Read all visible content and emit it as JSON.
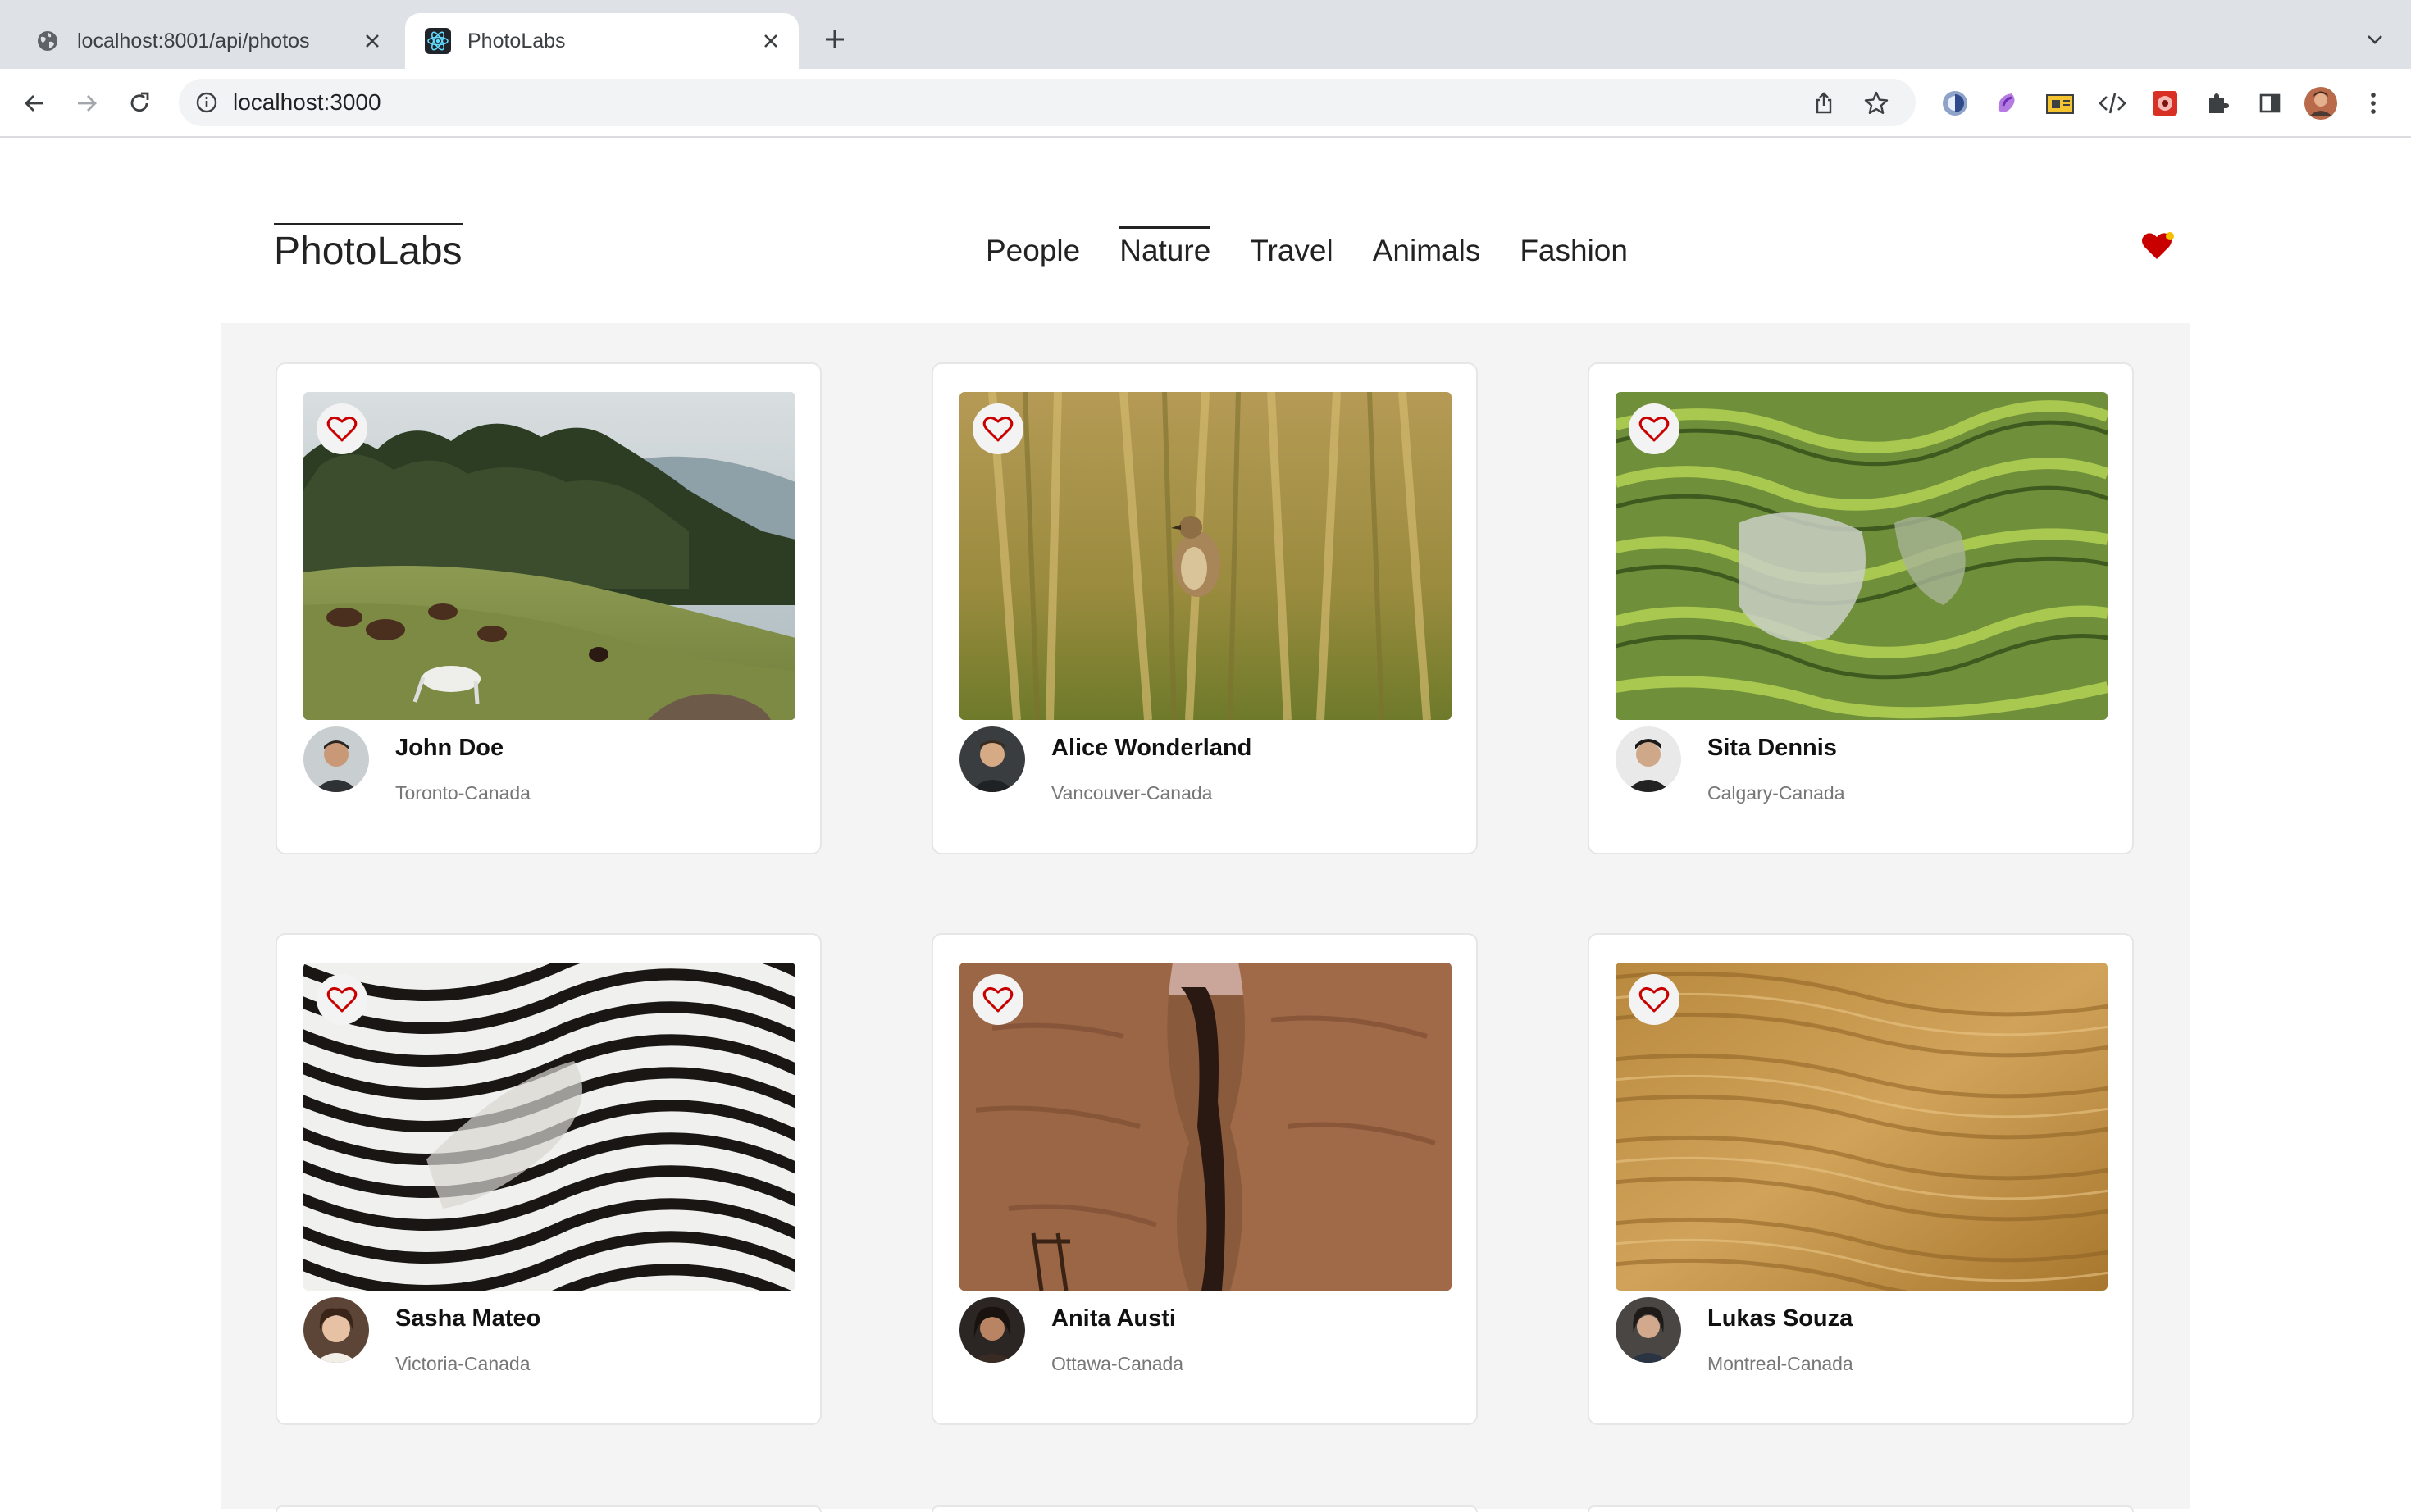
{
  "browser": {
    "tabs": [
      {
        "title": "localhost:8001/api/photos",
        "icon": "globe-icon",
        "active": false
      },
      {
        "title": "PhotoLabs",
        "icon": "react-icon",
        "active": true
      }
    ],
    "url": "localhost:3000"
  },
  "app": {
    "logo": "PhotoLabs",
    "topics": [
      "People",
      "Nature",
      "Travel",
      "Animals",
      "Fashion"
    ],
    "active_topic": "Nature",
    "fav_badge_icon": "heart-notification-icon",
    "accent_color": "#C80000",
    "photos": [
      {
        "name": "John Doe",
        "location": "Toronto-Canada",
        "image": "horses-grazing-hillside"
      },
      {
        "name": "Alice Wonderland",
        "location": "Vancouver-Canada",
        "image": "bird-in-reeds"
      },
      {
        "name": "Sita Dennis",
        "location": "Calgary-Canada",
        "image": "rice-terraces"
      },
      {
        "name": "Sasha Mateo",
        "location": "Victoria-Canada",
        "image": "zebra-stripes"
      },
      {
        "name": "Anita Austi",
        "location": "Ottawa-Canada",
        "image": "rock-canyon"
      },
      {
        "name": "Lukas Souza",
        "location": "Montreal-Canada",
        "image": "sand-dunes"
      }
    ]
  }
}
